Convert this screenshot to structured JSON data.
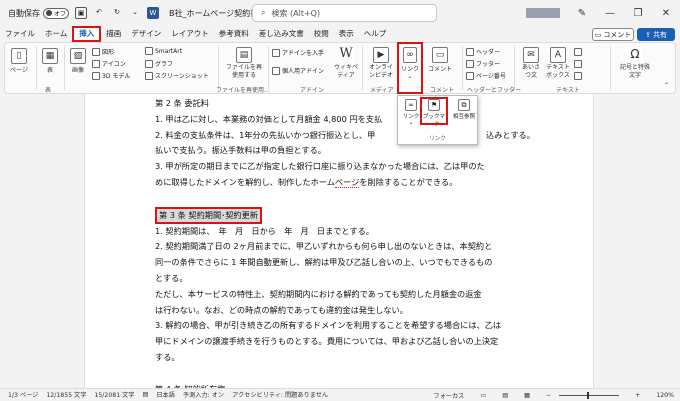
{
  "titlebar": {
    "autosave_label": "自動保存",
    "autosave_state": "オフ",
    "doc_title": "B社_ホームページ契約書 • この PC に保存済み",
    "search_placeholder": "検索 (Alt+Q)",
    "controls": [
      "—",
      "❐",
      "✕"
    ]
  },
  "tabs": [
    "ファイル",
    "ホーム",
    "挿入",
    "描画",
    "デザイン",
    "レイアウト",
    "参考資料",
    "差し込み文書",
    "校閲",
    "表示",
    "ヘルプ"
  ],
  "active_tab": "挿入",
  "buttons": {
    "comment": "コメント",
    "share": "共有"
  },
  "ribbon": {
    "page": "ページ",
    "table": "表",
    "image": "画像",
    "shapes": "図形",
    "icons": "アイコン",
    "models3d": "3D モデル",
    "smartart": "SmartArt",
    "graph": "グラフ",
    "screenshot": "スクリーンショット",
    "file_reuse": "ファイルを再使用する",
    "get_addins": "アドインを入手",
    "my_addins": "個人用アドイン",
    "wikipedia": "ウィキペディア",
    "online_video": "オンラインビデオ",
    "link": "リンク",
    "comment": "コメント",
    "header": "ヘッダー",
    "footer": "フッター",
    "page_number": "ページ番号",
    "textbox": "テキストボックス",
    "symbol": "記号と特殊文字",
    "greeting": "あいさつ文"
  },
  "ribbon_groups": {
    "table": "表",
    "file_reuse": "ファイルを再使用...",
    "addins": "アドイン",
    "media": "メディア",
    "comment": "コメント",
    "header_footer": "ヘッダーとフッター",
    "text": "テキスト"
  },
  "link_dropdown": {
    "items": [
      "リンク",
      "ブックマーク",
      "相互参照"
    ],
    "group_label": "リンク"
  },
  "document": {
    "art2_title": "第 2 条 委託料",
    "art2_p1": "1. 甲は乙に対し、本業務の対価として月額金 4,800 円を支払",
    "art2_p2a": "2. 料金の支払条件は、1年分の先払いかつ銀行振込とし、甲",
    "art2_p2b": "込みとする。",
    "art2_p2c": "払いで支払う。振込手数料は甲の負担とする。",
    "art2_p3a": "3. 甲が所定の期日までに乙が指定した銀行口座に振り込まなかった場合には、乙は甲のた",
    "art2_p3b_pre": "めに取得したドメインを解約し、制作したホーム",
    "art2_p3b_wave": "ページ",
    "art2_p3b_post": "を削除することができる。",
    "art3_title": "第 3 条 契約期間･契約更新",
    "art3_p1": "1. 契約期間は、　年　月　日から　年　月　日までとする。",
    "art3_p2a": "2. 契約期間満了日の 2ヶ月前までに、甲乙いずれからも何ら申し出のないときは、本契約と",
    "art3_p2b": "同一の条件でさらに 1 年間自動更新し、解約は甲及び乙話し合いの上、いつでもできるもの",
    "art3_p2c": "とする。",
    "art3_p3a": "ただし、本サービスの特性上、契約期間内における解約であっても契約した月額金の返金",
    "art3_p3b": "は行わない。なお、どの時点の解約であっても違約金は発生しない。",
    "art3_p4a": "3. 解約の場合、甲が引き続き乙の所有するドメインを利用することを希望する場合には、乙は",
    "art3_p4b": "甲にドメインの譲渡手続きを行うものとする。費用については、甲および乙話し合いの上決定",
    "art3_p4c": "する。",
    "art4_title": "第 4 条 知的所有権"
  },
  "statusbar": {
    "page": "1/3 ページ",
    "words": "12/1855 文字",
    "chars": "15/2081 文字",
    "language": "日本語",
    "input": "予測入力: オン",
    "accessibility": "アクセシビリティ: 問題ありません",
    "focus": "フォーカス",
    "zoom": "120%"
  }
}
